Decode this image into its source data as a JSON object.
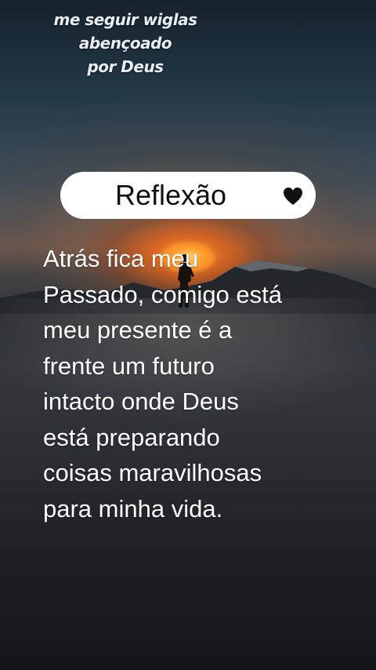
{
  "watermark": {
    "line1": "me seguir wiglas abençoado",
    "line2": "por Deus"
  },
  "card": {
    "title": "Reflexão",
    "icon": "heart-icon"
  },
  "quote": {
    "lines": [
      "Atrás fica meu",
      "Passado, comigo está",
      "meu presente é a",
      "frente um futuro",
      "intacto onde Deus",
      "está preparando",
      "coisas maravilhosas",
      "para minha vida."
    ]
  },
  "colors": {
    "text": "#ffffff",
    "pill_bg": "#ffffff",
    "pill_text": "#111111",
    "sun": "#ff9a2a"
  }
}
